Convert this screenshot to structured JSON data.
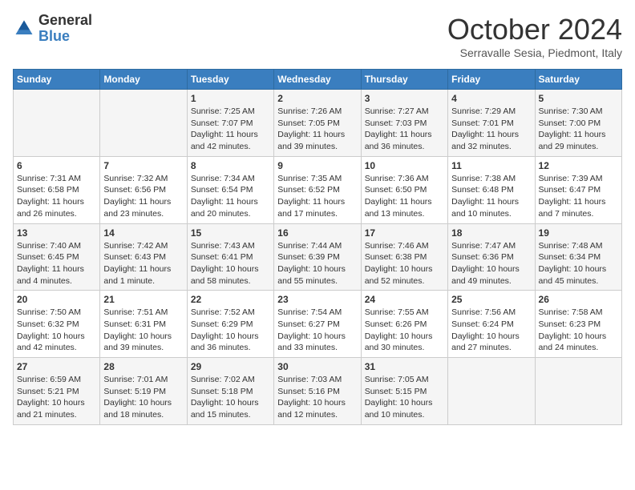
{
  "header": {
    "logo_general": "General",
    "logo_blue": "Blue",
    "month_title": "October 2024",
    "location": "Serravalle Sesia, Piedmont, Italy"
  },
  "columns": [
    "Sunday",
    "Monday",
    "Tuesday",
    "Wednesday",
    "Thursday",
    "Friday",
    "Saturday"
  ],
  "weeks": [
    [
      {
        "day": "",
        "detail": ""
      },
      {
        "day": "",
        "detail": ""
      },
      {
        "day": "1",
        "detail": "Sunrise: 7:25 AM\nSunset: 7:07 PM\nDaylight: 11 hours and 42 minutes."
      },
      {
        "day": "2",
        "detail": "Sunrise: 7:26 AM\nSunset: 7:05 PM\nDaylight: 11 hours and 39 minutes."
      },
      {
        "day": "3",
        "detail": "Sunrise: 7:27 AM\nSunset: 7:03 PM\nDaylight: 11 hours and 36 minutes."
      },
      {
        "day": "4",
        "detail": "Sunrise: 7:29 AM\nSunset: 7:01 PM\nDaylight: 11 hours and 32 minutes."
      },
      {
        "day": "5",
        "detail": "Sunrise: 7:30 AM\nSunset: 7:00 PM\nDaylight: 11 hours and 29 minutes."
      }
    ],
    [
      {
        "day": "6",
        "detail": "Sunrise: 7:31 AM\nSunset: 6:58 PM\nDaylight: 11 hours and 26 minutes."
      },
      {
        "day": "7",
        "detail": "Sunrise: 7:32 AM\nSunset: 6:56 PM\nDaylight: 11 hours and 23 minutes."
      },
      {
        "day": "8",
        "detail": "Sunrise: 7:34 AM\nSunset: 6:54 PM\nDaylight: 11 hours and 20 minutes."
      },
      {
        "day": "9",
        "detail": "Sunrise: 7:35 AM\nSunset: 6:52 PM\nDaylight: 11 hours and 17 minutes."
      },
      {
        "day": "10",
        "detail": "Sunrise: 7:36 AM\nSunset: 6:50 PM\nDaylight: 11 hours and 13 minutes."
      },
      {
        "day": "11",
        "detail": "Sunrise: 7:38 AM\nSunset: 6:48 PM\nDaylight: 11 hours and 10 minutes."
      },
      {
        "day": "12",
        "detail": "Sunrise: 7:39 AM\nSunset: 6:47 PM\nDaylight: 11 hours and 7 minutes."
      }
    ],
    [
      {
        "day": "13",
        "detail": "Sunrise: 7:40 AM\nSunset: 6:45 PM\nDaylight: 11 hours and 4 minutes."
      },
      {
        "day": "14",
        "detail": "Sunrise: 7:42 AM\nSunset: 6:43 PM\nDaylight: 11 hours and 1 minute."
      },
      {
        "day": "15",
        "detail": "Sunrise: 7:43 AM\nSunset: 6:41 PM\nDaylight: 10 hours and 58 minutes."
      },
      {
        "day": "16",
        "detail": "Sunrise: 7:44 AM\nSunset: 6:39 PM\nDaylight: 10 hours and 55 minutes."
      },
      {
        "day": "17",
        "detail": "Sunrise: 7:46 AM\nSunset: 6:38 PM\nDaylight: 10 hours and 52 minutes."
      },
      {
        "day": "18",
        "detail": "Sunrise: 7:47 AM\nSunset: 6:36 PM\nDaylight: 10 hours and 49 minutes."
      },
      {
        "day": "19",
        "detail": "Sunrise: 7:48 AM\nSunset: 6:34 PM\nDaylight: 10 hours and 45 minutes."
      }
    ],
    [
      {
        "day": "20",
        "detail": "Sunrise: 7:50 AM\nSunset: 6:32 PM\nDaylight: 10 hours and 42 minutes."
      },
      {
        "day": "21",
        "detail": "Sunrise: 7:51 AM\nSunset: 6:31 PM\nDaylight: 10 hours and 39 minutes."
      },
      {
        "day": "22",
        "detail": "Sunrise: 7:52 AM\nSunset: 6:29 PM\nDaylight: 10 hours and 36 minutes."
      },
      {
        "day": "23",
        "detail": "Sunrise: 7:54 AM\nSunset: 6:27 PM\nDaylight: 10 hours and 33 minutes."
      },
      {
        "day": "24",
        "detail": "Sunrise: 7:55 AM\nSunset: 6:26 PM\nDaylight: 10 hours and 30 minutes."
      },
      {
        "day": "25",
        "detail": "Sunrise: 7:56 AM\nSunset: 6:24 PM\nDaylight: 10 hours and 27 minutes."
      },
      {
        "day": "26",
        "detail": "Sunrise: 7:58 AM\nSunset: 6:23 PM\nDaylight: 10 hours and 24 minutes."
      }
    ],
    [
      {
        "day": "27",
        "detail": "Sunrise: 6:59 AM\nSunset: 5:21 PM\nDaylight: 10 hours and 21 minutes."
      },
      {
        "day": "28",
        "detail": "Sunrise: 7:01 AM\nSunset: 5:19 PM\nDaylight: 10 hours and 18 minutes."
      },
      {
        "day": "29",
        "detail": "Sunrise: 7:02 AM\nSunset: 5:18 PM\nDaylight: 10 hours and 15 minutes."
      },
      {
        "day": "30",
        "detail": "Sunrise: 7:03 AM\nSunset: 5:16 PM\nDaylight: 10 hours and 12 minutes."
      },
      {
        "day": "31",
        "detail": "Sunrise: 7:05 AM\nSunset: 5:15 PM\nDaylight: 10 hours and 10 minutes."
      },
      {
        "day": "",
        "detail": ""
      },
      {
        "day": "",
        "detail": ""
      }
    ]
  ]
}
